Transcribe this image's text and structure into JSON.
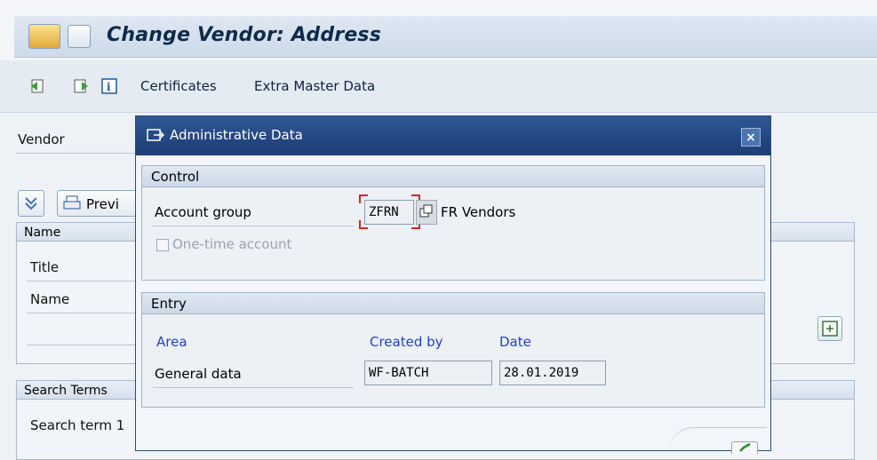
{
  "window": {
    "title": "Change Vendor: Address"
  },
  "toolbar": {
    "items": [
      {
        "label": "Certificates"
      },
      {
        "label": "Extra Master Data"
      }
    ]
  },
  "background_form": {
    "vendor_label": "Vendor",
    "preview_button_label": "Previ",
    "name_group_title": "Name",
    "title_label": "Title",
    "name_label": "Name",
    "search_group_title": "Search Terms",
    "search_term_label": "Search term 1"
  },
  "dialog": {
    "title": "Administrative Data",
    "control": {
      "title": "Control",
      "account_group_label": "Account group",
      "account_group_value": "ZFRN",
      "account_group_desc": "FR Vendors",
      "one_time_label": "One-time account",
      "one_time_checked": false
    },
    "entry": {
      "title": "Entry",
      "col_area": "Area",
      "col_created_by": "Created by",
      "col_date": "Date",
      "row_label": "General data",
      "created_by": "WF-BATCH",
      "date": "28.01.2019"
    }
  },
  "colors": {
    "dialog_title_bg": "#1d3c73",
    "accent_blue_text": "#1f3fd6",
    "selection_red": "#e02020"
  }
}
